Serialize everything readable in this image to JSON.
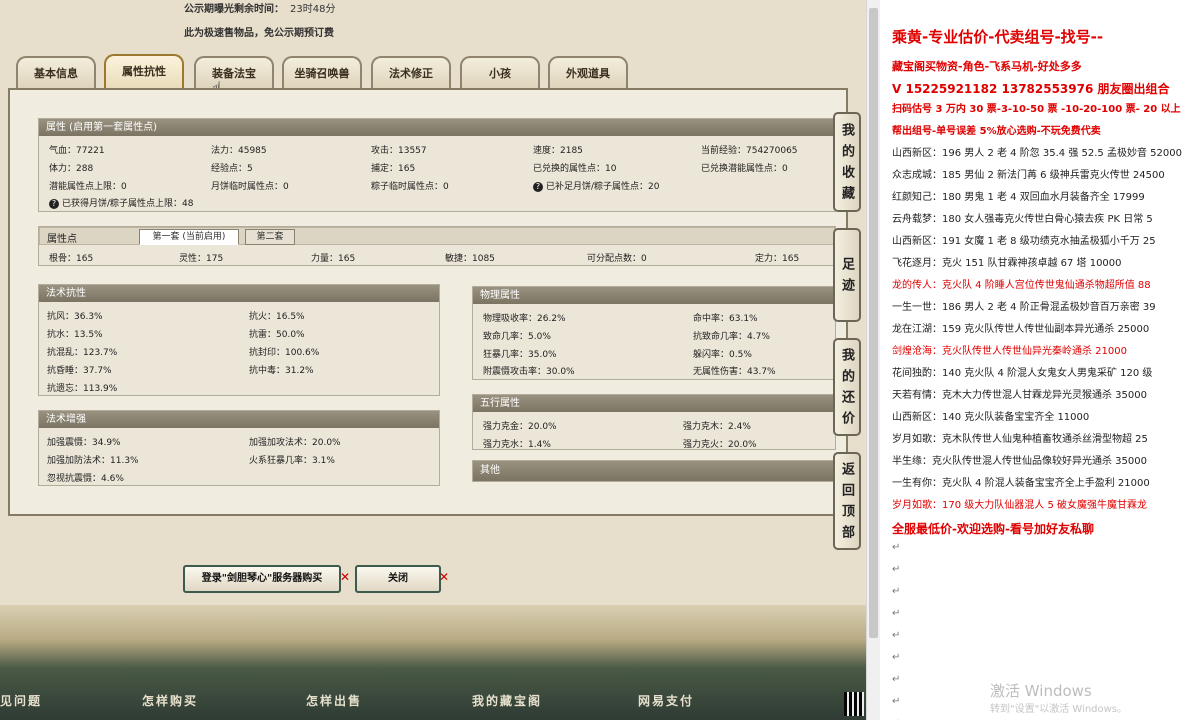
{
  "top_info": {
    "line1_label": "公示期曝光剩余时间：",
    "line1_value": "23时48分",
    "line2": "此为极速售物品，免公示期预订费"
  },
  "tabs": [
    {
      "label": "基本信息"
    },
    {
      "label": "属性抗性"
    },
    {
      "label": "装备法宝"
    },
    {
      "label": "坐骑召唤兽"
    },
    {
      "label": "法术修正"
    },
    {
      "label": "小孩"
    },
    {
      "label": "外观道具"
    }
  ],
  "attr_panel": {
    "title": "属性 (启用第一套属性点)",
    "row1": [
      "气血：77221",
      "法力：45985",
      "攻击：13557",
      "速度：2185",
      "当前经验：754270065"
    ],
    "row2": [
      "体力：288",
      "经验点：5",
      "捕定：165",
      "已兑换的属性点：10",
      "已兑换潜能属性点：0"
    ],
    "row3": [
      "潜能属性点上限：0",
      "月饼临时属性点：0",
      "粽子临时属性点：0",
      "已补足月饼/粽子属性点：20"
    ],
    "row4": "已获得月饼/粽子属性点上限：48"
  },
  "points_panel": {
    "title": "属性点",
    "tab1": "第一套 (当前启用)",
    "tab2": "第二套",
    "values": [
      "根骨：165",
      "灵性：175",
      "力量：165",
      "敏捷：1085",
      "可分配点数：0",
      "定力：165"
    ]
  },
  "resist_panel": {
    "title": "法术抗性",
    "items": [
      "抗风：36.3%",
      "抗火：16.5%",
      "抗水：13.5%",
      "抗雷：50.0%",
      "抗混乱：123.7%",
      "抗封印：100.6%",
      "抗昏睡：37.7%",
      "抗中毒：31.2%",
      "抗遗忘：113.9%"
    ]
  },
  "boost_panel": {
    "title": "法术增强",
    "items": [
      "加强震慑：34.9%",
      "加强加攻法术：20.0%",
      "加强加防法术：11.3%",
      "火系狂暴几率：3.1%",
      "忽视抗震慑：4.6%"
    ]
  },
  "phys_panel": {
    "title": "物理属性",
    "items": [
      "物理吸收率：26.2%",
      "命中率：63.1%",
      "致命几率：5.0%",
      "抗致命几率：4.7%",
      "狂暴几率：35.0%",
      "躲闪率：0.5%",
      "附震慑攻击率：30.0%",
      "无属性伤害：43.7%"
    ]
  },
  "five_panel": {
    "title": "五行属性",
    "items": [
      "强力克金：20.0%",
      "强力克木：2.4%",
      "强力克水：1.4%",
      "强力克火：20.0%"
    ]
  },
  "other_panel": {
    "title": "其他"
  },
  "side_buttons": [
    "我的收藏",
    "足迹",
    "我的还价",
    "返回顶部"
  ],
  "bottom_buttons": {
    "login": "登录\"剑胆琴心\"服务器购买",
    "close": "关闭"
  },
  "footer_links": [
    "见问题",
    "怎样购买",
    "怎样出售",
    "我的藏宝阁",
    "网易支付"
  ],
  "right_doc": {
    "lines": [
      {
        "text": "乘黄-专业估价-代卖组号-找号--",
        "color": "#e00000",
        "size": 15
      },
      {
        "text": "藏宝阁买物资-角色-飞系马机-好处多多",
        "color": "#e00000",
        "size": 11
      },
      {
        "text": "V 15225921182  13782553976 朋友圈出组合",
        "color": "#e00000",
        "size": 12
      },
      {
        "text": "扫码估号 3 万内 30 票-3-10-50 票 -10-20-100 票- 20 以上",
        "color": "#e00000",
        "size": 10
      },
      {
        "text": "帮出组号-单号误差 5%放心选购-不玩免费代卖",
        "color": "#e00000",
        "size": 10
      },
      {
        "text": "山西新区：196 男人 2 老 4 阶忽 35.4 强 52.5 孟极妙音 52000",
        "color": "#222222",
        "size": 10
      },
      {
        "text": "众志成城：185 男仙 2 新法门苒 6 级神兵雷克火传世 24500",
        "color": "#222222",
        "size": 10
      },
      {
        "text": "红颜知己：180 男鬼 1 老 4 双回血水月装备齐全 17999",
        "color": "#222222",
        "size": 10
      },
      {
        "text": "云舟载梦：180 女人强毒克火传世白骨心猿去疾 PK 日常 5",
        "color": "#222222",
        "size": 10
      },
      {
        "text": "山西新区：191 女魔 1 老 8 级功绩克水抽孟极狐小千万 25",
        "color": "#222222",
        "size": 10
      },
      {
        "text": "飞花逐月：克火 151 队甘霖神孩卓越 67 塔 10000",
        "color": "#222222",
        "size": 10
      },
      {
        "text": "龙的传人：克火队 4 阶睡人宫位传世鬼仙通杀物超所值 88",
        "color": "#e00000",
        "size": 10
      },
      {
        "text": "一生一世：186 男人 2 老 4 阶正骨混孟极妙音百万亲密 39",
        "color": "#222222",
        "size": 10
      },
      {
        "text": "龙在江湖：159 克火队传世人传世仙副本异光通杀 25000",
        "color": "#222222",
        "size": 10
      },
      {
        "text": "剑煌沧海：克火队传世人传世仙异光秦岭通杀 21000",
        "color": "#e00000",
        "size": 10
      },
      {
        "text": "花间独酌：140 克火队 4 阶混人女鬼女人男鬼采矿 120 级",
        "color": "#222222",
        "size": 10
      },
      {
        "text": "天若有情：克木大力传世混人甘霖龙异光灵猴通杀 35000",
        "color": "#222222",
        "size": 10
      },
      {
        "text": "山西新区：140 克火队装备宝宝齐全 11000",
        "color": "#222222",
        "size": 10
      },
      {
        "text": "岁月如歌：克木队传世人仙鬼种植畜牧通杀丝滑型物超 25",
        "color": "#222222",
        "size": 10
      },
      {
        "text": "半生缘：克火队传世混人传世仙品像较好异光通杀 35000",
        "color": "#222222",
        "size": 10
      },
      {
        "text": "一生有你：克火队 4 阶混人装备宝宝齐全上手盈利 21000",
        "color": "#222222",
        "size": 10
      },
      {
        "text": "岁月如歌：170 级大力队仙器混人 5 破女魔强牛魔甘霖龙",
        "color": "#e00000",
        "size": 10
      },
      {
        "text": "全服最低价-欢迎选购-看号加好友私聊",
        "color": "#e00000",
        "size": 12
      }
    ],
    "watermark_title": "激活 Windows",
    "watermark_sub": "转到\"设置\"以激活 Windows。"
  }
}
